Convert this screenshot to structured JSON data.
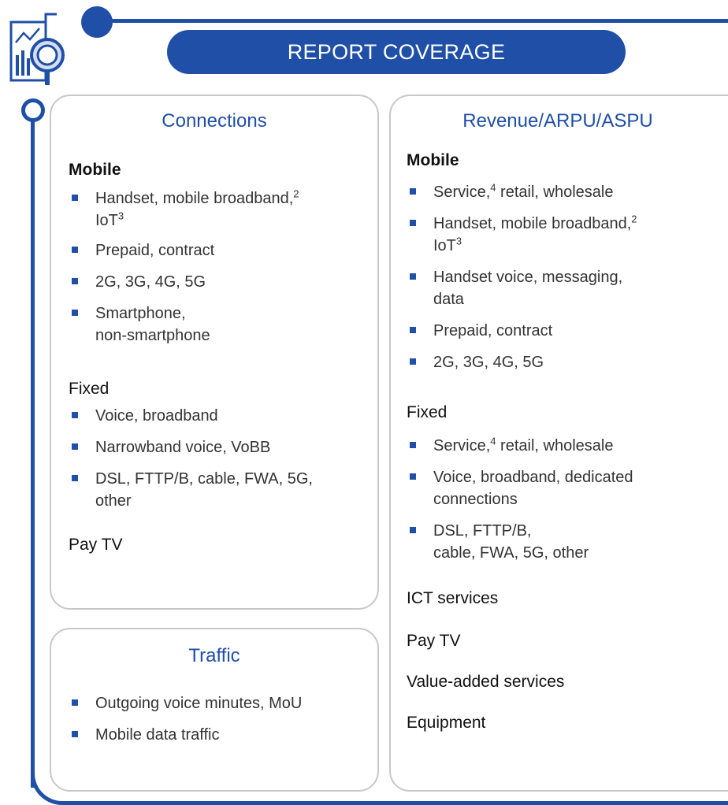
{
  "header": {
    "title": "REPORT COVERAGE"
  },
  "icon": {
    "name": "report-magnifier-icon"
  },
  "colors": {
    "accent": "#1f4fa7",
    "border": "#c8c8c8"
  },
  "connections": {
    "title": "Connections",
    "mobile": {
      "heading": "Mobile",
      "items": [
        {
          "text": "Handset, mobile broadband,",
          "sup": "2",
          "text2": "IoT",
          "sup2": "3"
        },
        {
          "text": "Prepaid, contract"
        },
        {
          "text": "2G, 3G, 4G, 5G"
        },
        {
          "text": "Smartphone,",
          "text2": "non-smartphone"
        }
      ]
    },
    "fixed": {
      "heading": "Fixed",
      "items": [
        {
          "text": "Voice, broadband"
        },
        {
          "text": "Narrowband voice, VoBB"
        },
        {
          "text": "DSL, FTTP/B, cable, FWA, 5G,",
          "text2": "other"
        }
      ]
    },
    "paytv": {
      "heading": "Pay TV"
    }
  },
  "traffic": {
    "title": "Traffic",
    "items": [
      {
        "text": "Outgoing voice minutes, MoU"
      },
      {
        "text": "Mobile data traffic"
      }
    ]
  },
  "revenue": {
    "title": "Revenue/ARPU/ASPU",
    "mobile": {
      "heading": "Mobile",
      "items": [
        {
          "text": "Service,",
          "sup": "4",
          "text_after": " retail, wholesale"
        },
        {
          "text": "Handset, mobile broadband,",
          "sup": "2",
          "text2": "IoT",
          "sup2": "3"
        },
        {
          "text": "Handset voice, messaging,",
          "text2": "data"
        },
        {
          "text": "Prepaid, contract"
        },
        {
          "text": "2G, 3G, 4G, 5G"
        }
      ]
    },
    "fixed": {
      "heading": "Fixed",
      "items": [
        {
          "text": "Service,",
          "sup": "4",
          "text_after": " retail, wholesale"
        },
        {
          "text": "Voice, broadband, dedicated",
          "text2": "connections"
        },
        {
          "text": "DSL, FTTP/B,",
          "text2": "cable, FWA, 5G, other"
        }
      ]
    },
    "ict": {
      "heading": "ICT services"
    },
    "paytv": {
      "heading": "Pay TV"
    },
    "vas": {
      "heading": "Value-added services"
    },
    "equipment": {
      "heading": "Equipment"
    }
  }
}
